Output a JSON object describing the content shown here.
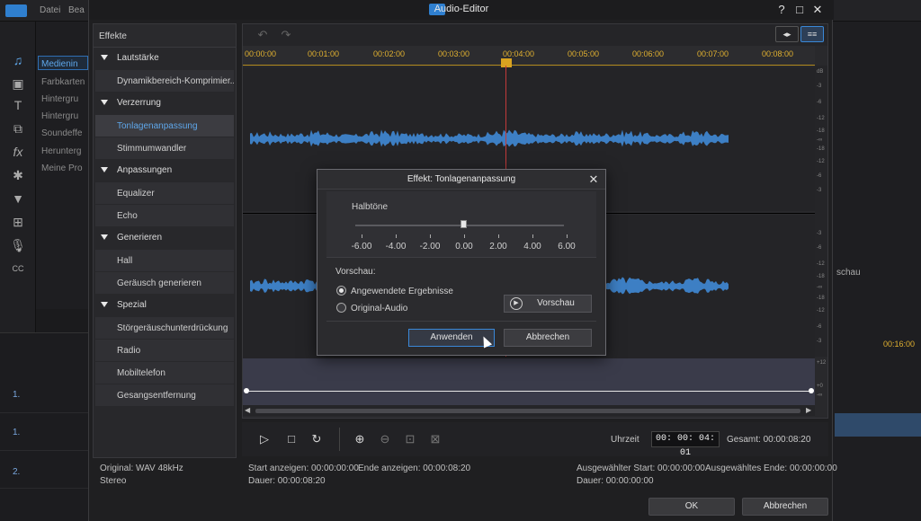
{
  "background_app": {
    "menu": [
      "Datei",
      "Bea"
    ],
    "library_items": [
      "Medienin",
      "Farbkarten",
      "Hintergru",
      "Hintergru",
      "Soundeffe",
      "Herunterg",
      "Meine Pro"
    ],
    "right_fragment": "schau",
    "right_timecode": "00:16:00",
    "track_labels": [
      "1.",
      "1.",
      "2."
    ]
  },
  "window": {
    "title": "Audio-Editor",
    "controls": {
      "help": "?",
      "maximize": "□",
      "close": "✕"
    }
  },
  "effects": {
    "header": "Effekte",
    "categories": [
      {
        "label": "Lautstärke",
        "items": [
          "Dynamikbereich-Komprimier..."
        ]
      },
      {
        "label": "Verzerrung",
        "items": [
          "Tonlagenanpassung",
          "Stimmumwandler"
        ]
      },
      {
        "label": "Anpassungen",
        "items": [
          "Equalizer",
          "Echo"
        ]
      },
      {
        "label": "Generieren",
        "items": [
          "Hall",
          "Geräusch generieren"
        ]
      },
      {
        "label": "Spezial",
        "items": [
          "Störgeräuschunterdrückung",
          "Radio",
          "Mobiltelefon",
          "Gesangsentfernung"
        ]
      }
    ],
    "selected_item": "Tonlagenanpassung"
  },
  "ruler": {
    "labels": [
      "00:00:00",
      "00:01:00",
      "00:02:00",
      "00:03:00",
      "00:04:00",
      "00:05:00",
      "00:06:00",
      "00:07:00",
      "00:08:00"
    ],
    "marker_color": "#d9a320"
  },
  "db_scale": {
    "top": [
      "dB",
      "-3",
      "-6",
      "-12",
      "-18",
      "-∞",
      "-18",
      "-12",
      "-6",
      "-3"
    ],
    "bottom": [
      "-3",
      "-6",
      "-12",
      "-18",
      "-∞",
      "-18",
      "-12",
      "-6",
      "-3"
    ],
    "envelope": [
      "+12",
      "+0",
      "-∞"
    ]
  },
  "transport": {
    "time_label": "Uhrzeit",
    "current_time": "00: 00: 04: 01",
    "total_label": "Gesamt: 00:00:08:20"
  },
  "status": {
    "original": "Original: WAV 48kHz",
    "channels": "Stereo",
    "start_show": "Start anzeigen: 00:00:00:00",
    "end_show": "Ende anzeigen: 00:00:08:20",
    "duration": "Dauer: 00:00:08:20",
    "selected_start": "Ausgewählter Start: 00:00:00:00",
    "selected_end": "Ausgewähltes Ende: 00:00:00:00",
    "selected_duration": "Dauer: 00:00:00:00"
  },
  "footer": {
    "ok": "OK",
    "cancel": "Abbrechen"
  },
  "dialog": {
    "title": "Effekt: Tonlagenanpassung",
    "slider_label": "Halbtöne",
    "slider_value": 0.0,
    "slider_min": -6.0,
    "slider_max": 6.0,
    "scale": [
      "-6.00",
      "-4.00",
      "-2.00",
      "0.00",
      "2.00",
      "4.00",
      "6.00"
    ],
    "preview_label": "Vorschau:",
    "option_applied": "Angewendete Ergebnisse",
    "option_original": "Original-Audio",
    "selected_option": "Angewendete Ergebnisse",
    "preview_button": "Vorschau",
    "apply_button": "Anwenden",
    "cancel_button": "Abbrechen"
  },
  "colors": {
    "accent": "#2f7fcf",
    "waveform": "#3d7fc4",
    "playhead": "#c23a3a",
    "selected_effect": "#5fa7ea"
  }
}
